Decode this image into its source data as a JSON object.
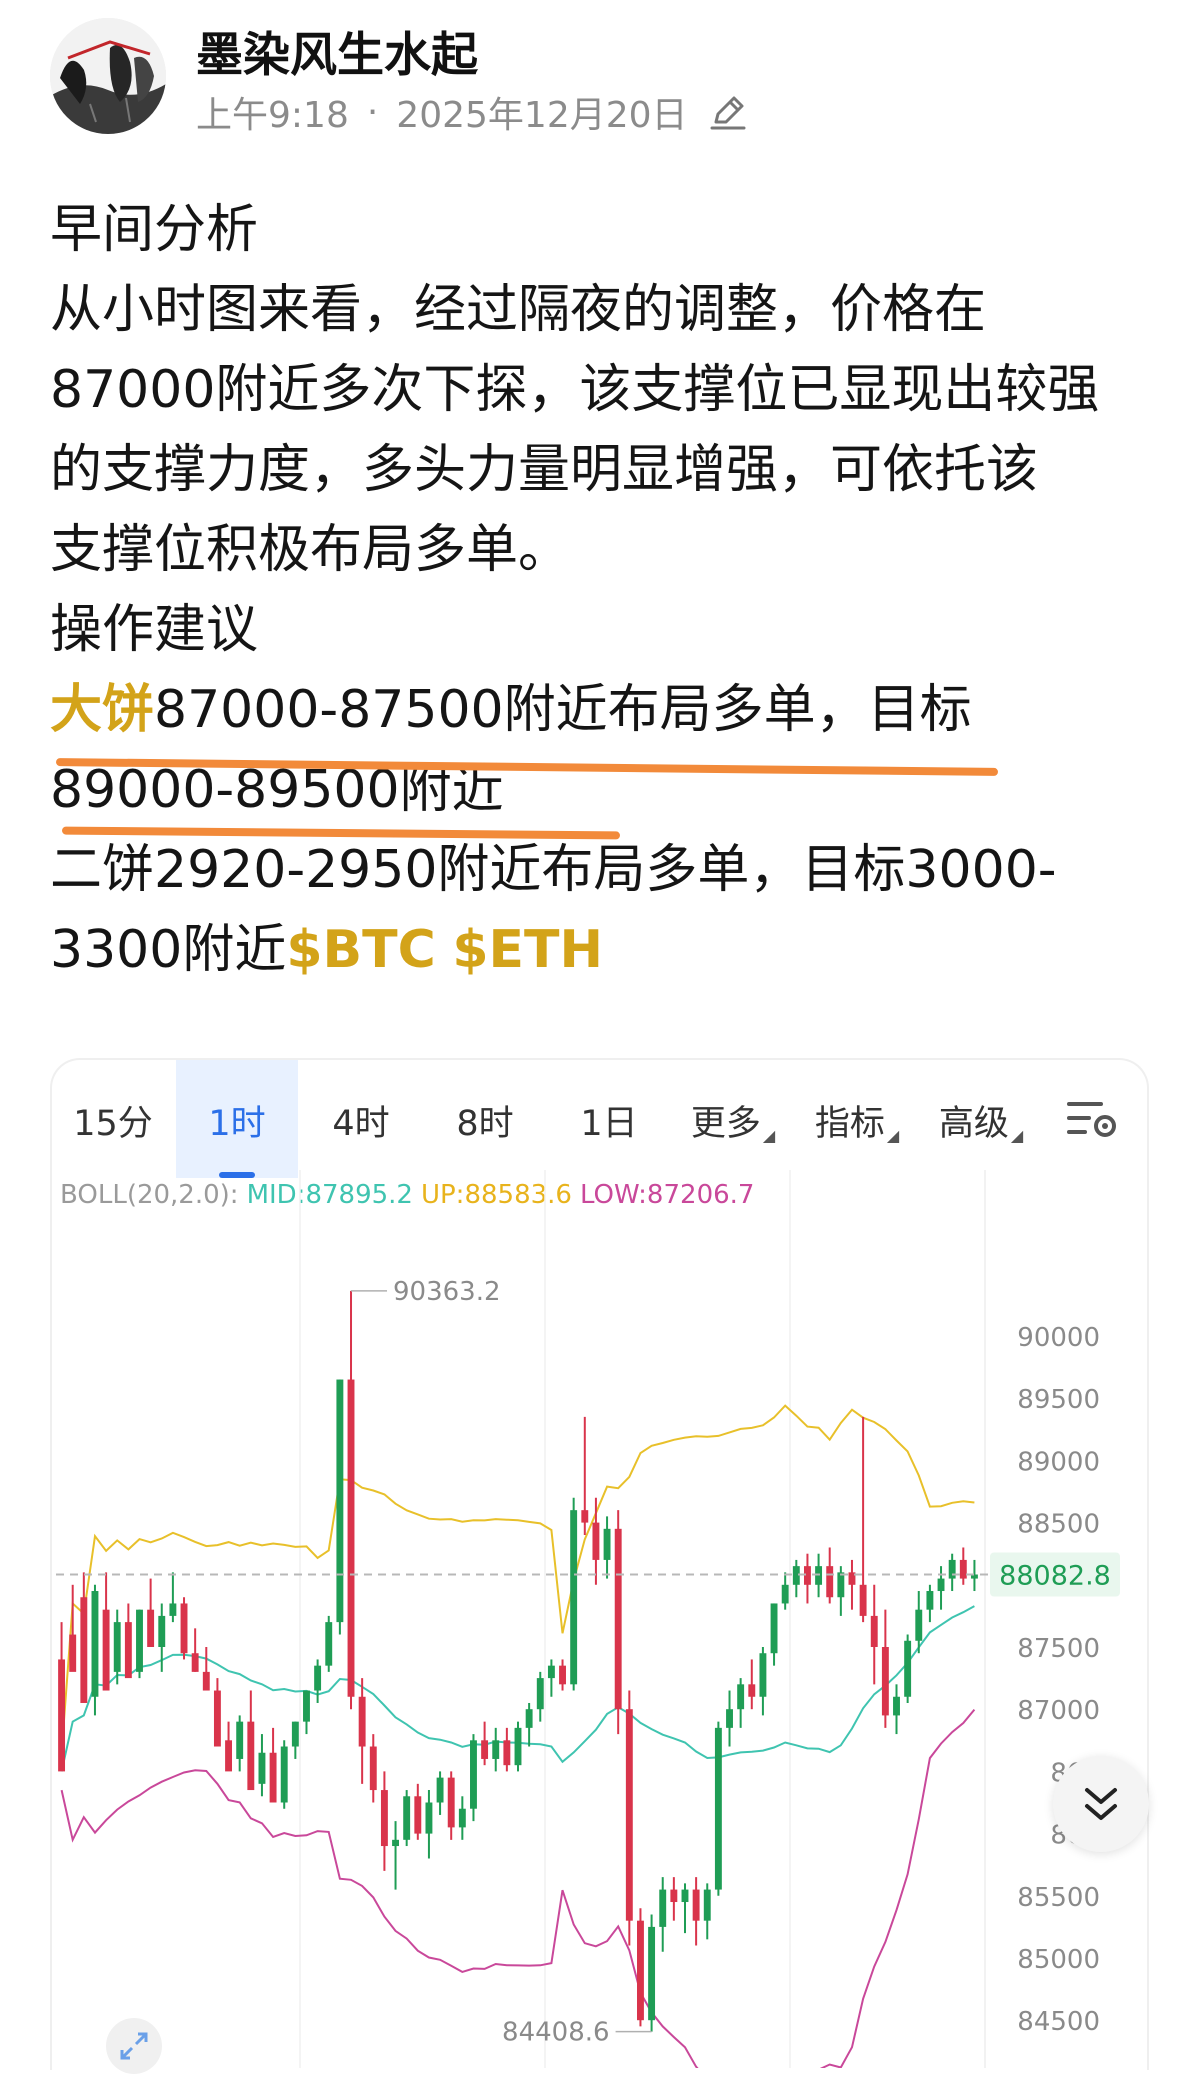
{
  "author": {
    "name": "墨染风生水起",
    "time": "上午9:18",
    "date": "2025年12月20日"
  },
  "icons": {
    "edit": "pencil-edit-icon",
    "settings": "chart-settings-icon",
    "scroll": "double-chevron-down-icon",
    "expand": "expand-arrows-icon"
  },
  "colors": {
    "accent_gold": "#d3a319",
    "underline_orange": "#f28a3a",
    "candle_up": "#1f9d55",
    "candle_down": "#d9344b",
    "boll_mid": "#3fc4b0",
    "boll_up": "#e8c02a",
    "boll_low": "#c9489a",
    "active_tab": "#2b6fe8"
  },
  "post": {
    "heading": "早间分析",
    "paragraph": "从小时图来看，经过隔夜的调整，价格在87000附近多次下探，该支撑位已显现出较强的支撑力度，多头力量明显增强，可依托该支撑位积极布局多单。",
    "line1": "从小时图来看，经过隔夜的调整，价格在",
    "line2": "87000附近多次下探，该支撑位已显现出较强",
    "line3": "的支撑力度，多头力量明显增强，可依托该",
    "line4": "支撑位积极布局多单。",
    "advice_heading": "操作建议",
    "btc_label": "大饼",
    "btc_text_a": "87000-87500附近布局多单，目标",
    "btc_text_b": "89000-89500附近",
    "eth_text_a": "二饼2920-2950附近布局多单，目标3000-",
    "eth_text_b": "3300附近",
    "tag_btc": "$BTC",
    "tag_eth": "$ETH"
  },
  "chart": {
    "tabs": [
      {
        "label": "15分"
      },
      {
        "label": "1时",
        "active": true
      },
      {
        "label": "4时"
      },
      {
        "label": "8时"
      },
      {
        "label": "1日"
      },
      {
        "label": "更多",
        "dropdown": true
      },
      {
        "label": "指标",
        "dropdown": true
      },
      {
        "label": "高级",
        "dropdown": true
      }
    ],
    "boll_label": "BOLL(20,2.0):",
    "boll_mid": "MID:87895.2",
    "boll_up": "UP:88583.6",
    "boll_low": "LOW:87206.7",
    "high_label": "90363.2",
    "low_label": "84408.6",
    "current_price": "88082.8"
  },
  "chart_data": {
    "type": "candlestick",
    "interval": "1h",
    "y_axis_ticks": [
      90000,
      89500,
      89000,
      88500,
      88000,
      87500,
      87000,
      86500,
      86000,
      85500,
      85000,
      84500
    ],
    "y_axis_labels_visible": [
      "90000",
      "89500",
      "89000",
      "88500",
      "87500",
      "87000",
      "865",
      "860",
      "85500",
      "85000",
      "84500"
    ],
    "ylim": [
      84300,
      91100
    ],
    "annotations": {
      "high": 90363.2,
      "low": 84408.6,
      "last": 88082.8
    },
    "indicator": {
      "name": "BOLL",
      "params": "20,2.0",
      "mid": 87895.2,
      "up": 88583.6,
      "low": 87206.7
    },
    "candles": [
      [
        87400,
        87700,
        86700,
        86500
      ],
      [
        87600,
        88000,
        87500,
        87300
      ],
      [
        87900,
        88100,
        87200,
        87050
      ],
      [
        87100,
        88000,
        86950,
        87950
      ],
      [
        87800,
        88100,
        87400,
        87150
      ],
      [
        87300,
        87800,
        87200,
        87700
      ],
      [
        87700,
        87850,
        87300,
        87250
      ],
      [
        87300,
        87800,
        87250,
        87800
      ],
      [
        87800,
        88050,
        87600,
        87500
      ],
      [
        87500,
        87850,
        87300,
        87750
      ],
      [
        87750,
        88100,
        87700,
        87850
      ],
      [
        87850,
        87900,
        87400,
        87450
      ],
      [
        87450,
        87650,
        87300,
        87300
      ],
      [
        87300,
        87500,
        87200,
        87150
      ],
      [
        87150,
        87250,
        86800,
        86700
      ],
      [
        86750,
        86900,
        86600,
        86500
      ],
      [
        86600,
        86950,
        86500,
        86900
      ],
      [
        86900,
        87150,
        86400,
        86350
      ],
      [
        86400,
        86800,
        86300,
        86650
      ],
      [
        86650,
        86850,
        86250,
        86250
      ],
      [
        86250,
        86750,
        86200,
        86700
      ],
      [
        86700,
        86900,
        86600,
        86900
      ],
      [
        86900,
        87150,
        86800,
        87150
      ],
      [
        87150,
        87400,
        87050,
        87350
      ],
      [
        87350,
        87750,
        87300,
        87700
      ],
      [
        87700,
        89650,
        87600,
        89650
      ],
      [
        89650,
        90363.2,
        87000,
        87100
      ],
      [
        87100,
        87250,
        86400,
        86700
      ],
      [
        86700,
        86800,
        86250,
        86350
      ],
      [
        86350,
        86500,
        85700,
        85900
      ],
      [
        85900,
        86100,
        85550,
        85950
      ],
      [
        85950,
        86350,
        85900,
        86300
      ],
      [
        86300,
        86400,
        85950,
        86000
      ],
      [
        86000,
        86350,
        85800,
        86250
      ],
      [
        86250,
        86500,
        86150,
        86450
      ],
      [
        86450,
        86500,
        85950,
        86050
      ],
      [
        86050,
        86300,
        85950,
        86200
      ],
      [
        86200,
        86800,
        86100,
        86750
      ],
      [
        86750,
        86900,
        86550,
        86600
      ],
      [
        86600,
        86850,
        86500,
        86750
      ],
      [
        86750,
        86850,
        86500,
        86550
      ],
      [
        86550,
        86900,
        86500,
        86850
      ],
      [
        86850,
        87050,
        86700,
        87000
      ],
      [
        87000,
        87300,
        86900,
        87250
      ],
      [
        87250,
        87400,
        87100,
        87350
      ],
      [
        87350,
        87400,
        87150,
        87200
      ],
      [
        87200,
        88700,
        87150,
        88600
      ],
      [
        88600,
        89350,
        88400,
        88500
      ],
      [
        88500,
        88700,
        88000,
        88200
      ],
      [
        88200,
        88550,
        88050,
        88450
      ],
      [
        88450,
        88600,
        86800,
        87000
      ],
      [
        87000,
        87150,
        85100,
        85300
      ],
      [
        85300,
        85400,
        84450,
        84500
      ],
      [
        84500,
        85350,
        84408.6,
        85250
      ],
      [
        85250,
        85650,
        85050,
        85550
      ],
      [
        85550,
        85650,
        85300,
        85450
      ],
      [
        85450,
        85600,
        85200,
        85550
      ],
      [
        85550,
        85650,
        85100,
        85300
      ],
      [
        85300,
        85600,
        85150,
        85550
      ],
      [
        85550,
        86900,
        85500,
        86850
      ],
      [
        86850,
        87150,
        86700,
        87000
      ],
      [
        87000,
        87250,
        86850,
        87200
      ],
      [
        87200,
        87400,
        87000,
        87100
      ],
      [
        87100,
        87500,
        86950,
        87450
      ],
      [
        87450,
        87850,
        87350,
        87850
      ],
      [
        87850,
        88100,
        87800,
        88000
      ],
      [
        88000,
        88200,
        87900,
        88150
      ],
      [
        88150,
        88250,
        87850,
        88000
      ],
      [
        88000,
        88250,
        87900,
        88150
      ],
      [
        88150,
        88300,
        87850,
        87900
      ],
      [
        87900,
        88150,
        87750,
        88100
      ],
      [
        88100,
        88200,
        87800,
        88000
      ],
      [
        88000,
        89350,
        87700,
        87750
      ],
      [
        87750,
        88000,
        87200,
        87500
      ],
      [
        87500,
        87800,
        86850,
        86950
      ],
      [
        86950,
        87200,
        86800,
        87100
      ],
      [
        87100,
        87600,
        87050,
        87550
      ],
      [
        87550,
        87950,
        87450,
        87800
      ],
      [
        87800,
        88000,
        87700,
        87950
      ],
      [
        87950,
        88150,
        87800,
        88050
      ],
      [
        88050,
        88250,
        87950,
        88200
      ],
      [
        88200,
        88300,
        88000,
        88050
      ],
      [
        88050,
        88200,
        87950,
        88082.8
      ]
    ]
  }
}
